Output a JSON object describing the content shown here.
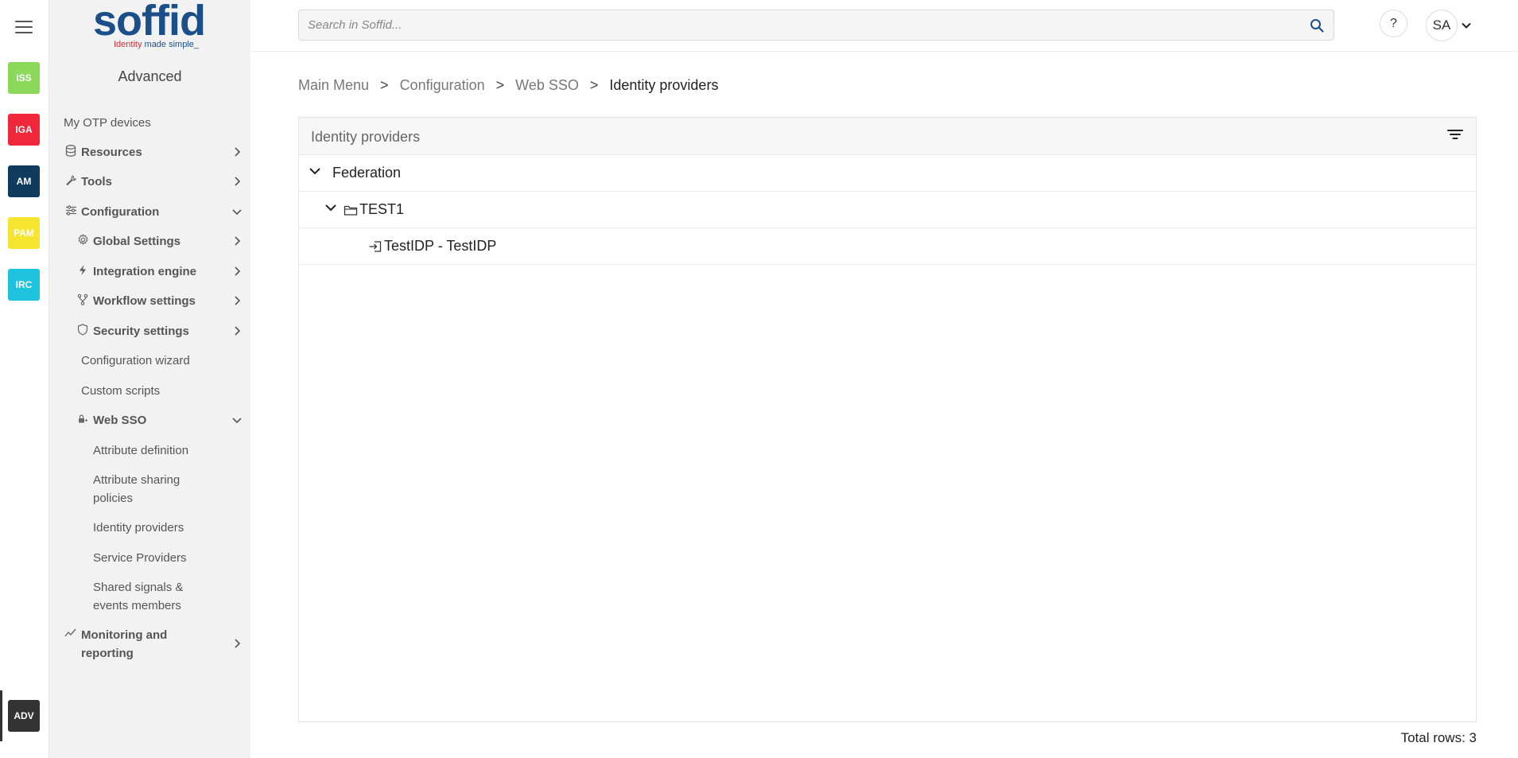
{
  "rail": {
    "apps": [
      {
        "label": "ISS",
        "color": "#8bd85a"
      },
      {
        "label": "IGA",
        "color": "#f0263a"
      },
      {
        "label": "AM",
        "color": "#0f3b5f"
      },
      {
        "label": "PAM",
        "color": "#f5e531"
      },
      {
        "label": "IRC",
        "color": "#1ec3e0"
      }
    ],
    "active_app": {
      "label": "ADV",
      "color": "#333333"
    }
  },
  "brand": {
    "name": "soffid",
    "tagline_red": "Identity",
    "tagline_rest": " made simple_"
  },
  "sidebar": {
    "title": "Advanced",
    "items": [
      {
        "label": "My OTP devices",
        "icon": "none"
      },
      {
        "label": "Resources",
        "icon": "database-icon"
      },
      {
        "label": "Tools",
        "icon": "wrench-icon"
      },
      {
        "label": "Configuration",
        "icon": "sliders-icon"
      },
      {
        "label": "Global Settings",
        "icon": "gear-icon"
      },
      {
        "label": "Integration engine",
        "icon": "lightning-icon"
      },
      {
        "label": "Workflow settings",
        "icon": "branch-icon"
      },
      {
        "label": "Security settings",
        "icon": "shield-icon"
      },
      {
        "label": "Configuration wizard",
        "icon": "none"
      },
      {
        "label": "Custom scripts",
        "icon": "none"
      },
      {
        "label": "Web SSO",
        "icon": "lock-icon"
      },
      {
        "label": "Attribute definition",
        "icon": "none"
      },
      {
        "label": "Attribute sharing policies",
        "icon": "none"
      },
      {
        "label": "Identity providers",
        "icon": "none"
      },
      {
        "label": "Service Providers",
        "icon": "none"
      },
      {
        "label": "Shared signals & events members",
        "icon": "none"
      },
      {
        "label": "Monitoring and reporting",
        "icon": "chart-line-icon"
      }
    ]
  },
  "topbar": {
    "search_placeholder": "Search in Soffid...",
    "help_label": "?",
    "user_initials": "SA"
  },
  "breadcrumb": {
    "items": [
      "Main Menu",
      "Configuration",
      "Web SSO"
    ],
    "current": "Identity providers",
    "separator": ">"
  },
  "panel": {
    "title": "Identity providers",
    "tree": [
      {
        "label": "Federation",
        "level": 0,
        "icon": "none"
      },
      {
        "label": "TEST1",
        "level": 1,
        "icon": "folder-icon"
      },
      {
        "label": "TestIDP - TestIDP",
        "level": 2,
        "icon": "login-icon"
      }
    ]
  },
  "footer": {
    "total_rows": "Total rows: 3"
  }
}
